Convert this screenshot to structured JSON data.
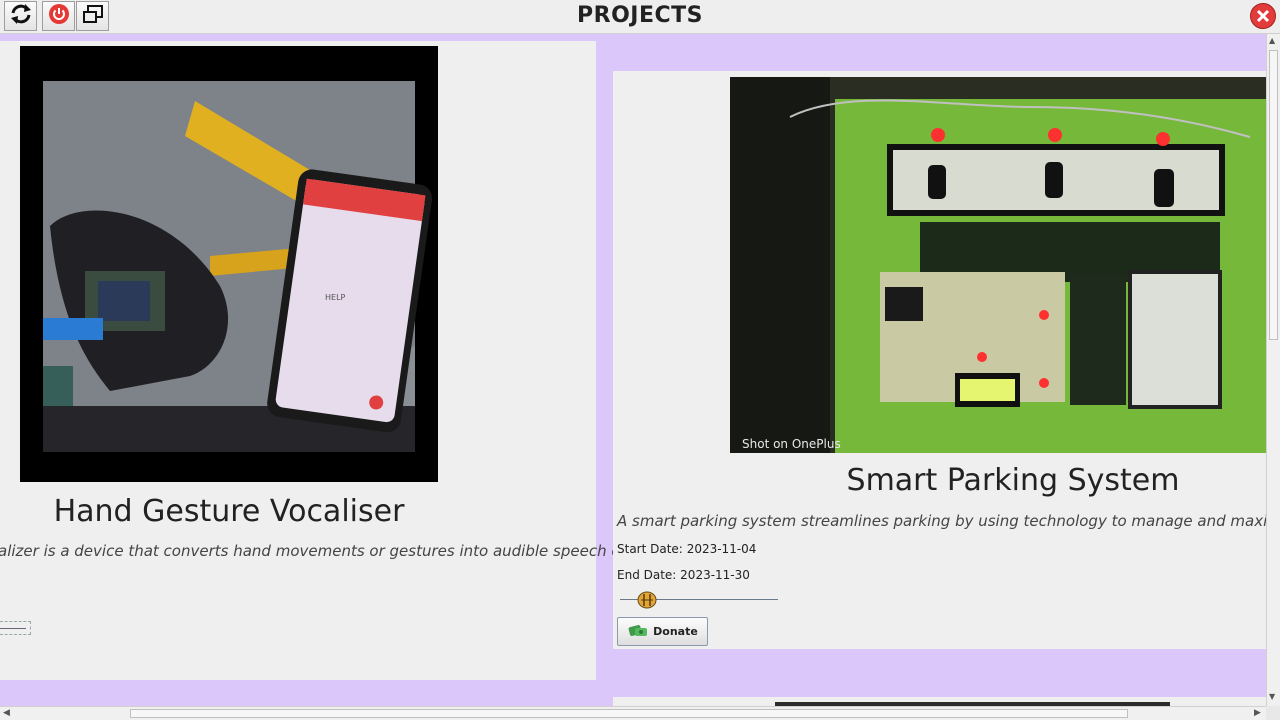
{
  "window": {
    "title": "PROJECTS",
    "buttons": [
      "refresh-icon",
      "power-icon",
      "window-restore-icon",
      "close-icon"
    ],
    "accent": "#dcc7fb",
    "close_color": "#e23b3b",
    "power_color": "#e53935"
  },
  "projects": [
    {
      "title": "Hand Gesture Vocaliser",
      "description": "alizer is a device that converts hand movements or gestures into audible speech or text.",
      "phone_text": "HELP"
    },
    {
      "title": "Smart Parking System",
      "description": "A smart parking system streamlines parking by using technology to manage and maximize parki",
      "start_label": "Start Date:",
      "start_date": "2023-11-04",
      "end_label": "End Date:",
      "end_date": "2023-11-30",
      "progress": 0.12,
      "donate_label": "Donate",
      "photo_caption": "Shot on OnePlus"
    }
  ]
}
